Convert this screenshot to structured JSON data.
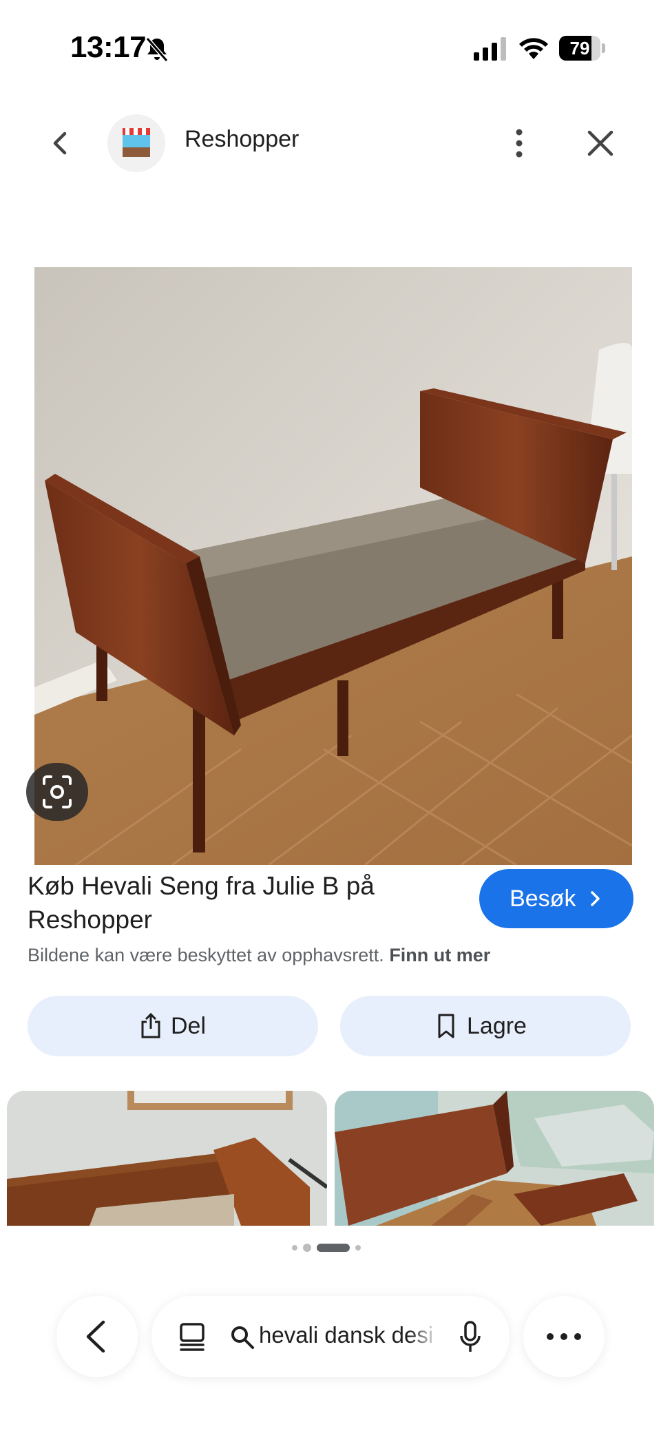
{
  "status_bar": {
    "time": "13:17",
    "battery_percent": "79",
    "battery_level": 0.79,
    "icons": [
      "bell-slash-icon",
      "cellular-signal-icon",
      "wifi-icon",
      "battery-icon"
    ]
  },
  "header": {
    "site_name": "Reshopper",
    "icons": [
      "chevron-left-icon",
      "reshopper-logo",
      "more-vertical-icon",
      "close-icon"
    ]
  },
  "result": {
    "title": "Køb Hevali Seng fra Julie B på Reshopper",
    "visit_label": "Besøk",
    "copyright_text": "Bildene kan være beskyttet av opphavsrett.",
    "learn_more_label": "Finn ut mer"
  },
  "actions": {
    "share_label": "Del",
    "save_label": "Lagre"
  },
  "carousel": {
    "page_count": 4,
    "active_page": 3
  },
  "bottom_bar": {
    "search_query": "hevali dansk desi",
    "icons": [
      "chevron-left-icon",
      "tabs-icon",
      "search-icon",
      "microphone-icon",
      "more-horizontal-icon"
    ]
  },
  "colors": {
    "accent": "#1a73e8",
    "pill_bg": "#e8effc",
    "secondary_text": "#5f6368"
  }
}
